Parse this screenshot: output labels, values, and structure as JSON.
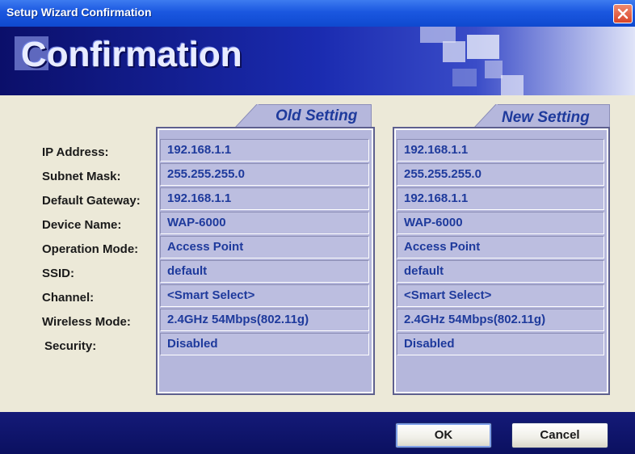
{
  "window": {
    "title": "Setup Wizard Confirmation",
    "heading": "Confirmation"
  },
  "labels": [
    "IP Address:",
    "Subnet Mask:",
    "Default Gateway:",
    "Device Name:",
    "Operation Mode:",
    "SSID:",
    "Channel:",
    "Wireless Mode:",
    "Security:"
  ],
  "old_setting": {
    "title": "Old Setting",
    "values": [
      "192.168.1.1",
      "255.255.255.0",
      "192.168.1.1",
      "WAP-6000",
      "Access Point",
      "default",
      "<Smart Select>",
      "2.4GHz 54Mbps(802.11g)",
      "Disabled"
    ]
  },
  "new_setting": {
    "title": "New Setting",
    "values": [
      "192.168.1.1",
      "255.255.255.0",
      "192.168.1.1",
      "WAP-6000",
      "Access Point",
      "default",
      "<Smart Select>",
      "2.4GHz 54Mbps(802.11g)",
      "Disabled"
    ]
  },
  "buttons": {
    "ok": "OK",
    "cancel": "Cancel"
  },
  "colors": {
    "title_bar": "#1a57e0",
    "banner": "#0b0f6a",
    "panel": "#b5b7dc",
    "value_text": "#1e3a9c",
    "close_button": "#d8452a"
  },
  "icons": {
    "close": "close-icon"
  }
}
